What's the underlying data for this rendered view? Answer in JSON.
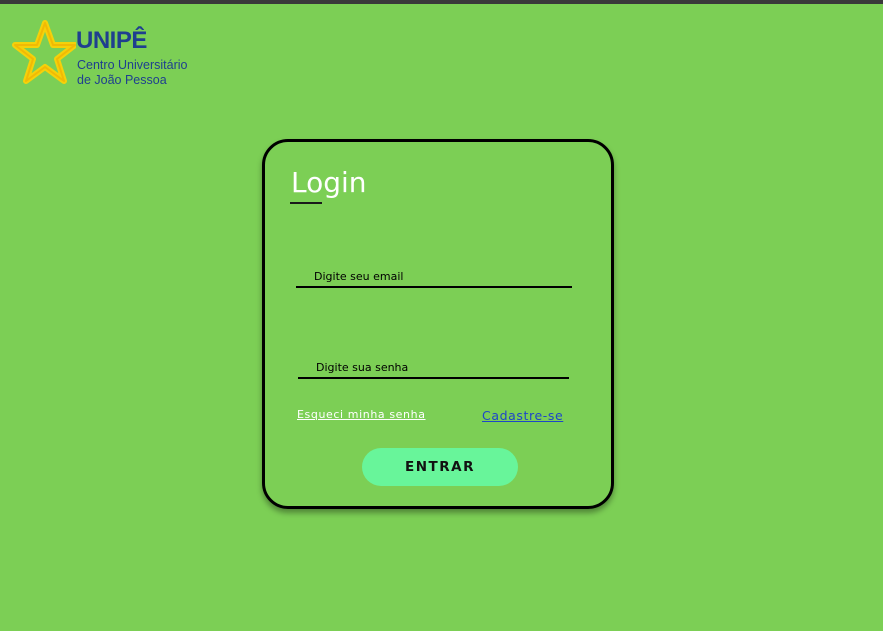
{
  "logo": {
    "title": "UNIPÊ",
    "subtitle_line1": "Centro Universitário",
    "subtitle_line2": "de João Pessoa"
  },
  "login": {
    "title": "Login",
    "email_placeholder": "Digite seu email",
    "password_placeholder": "Digite sua senha",
    "forgot_password_label": "Esqueci minha senha",
    "signup_label": "Cadastre-se",
    "submit_label": "ENTRAR"
  },
  "colors": {
    "background": "#7ccf55",
    "button": "#68f59a",
    "signup_link": "#1e46c8",
    "logo_text": "#1f3f8f",
    "logo_star": "#f5d10a"
  },
  "icons": {
    "logo_mark": "star-logo-icon"
  }
}
